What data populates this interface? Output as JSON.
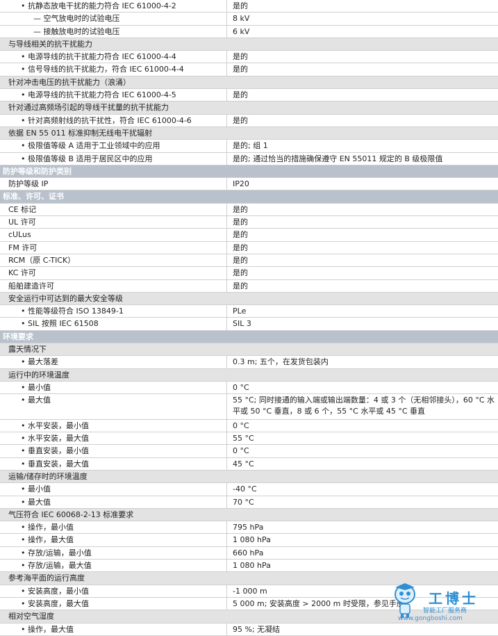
{
  "rows": [
    {
      "type": "item",
      "level": 1,
      "label": "抗静态放电干扰的能力符合 IEC 61000-4-2",
      "value": "是的"
    },
    {
      "type": "item",
      "level": 2,
      "label": "— 空气放电时的试验电压",
      "value": "8 kV"
    },
    {
      "type": "item",
      "level": 2,
      "label": "— 接触放电时的试验电压",
      "value": "6 kV"
    },
    {
      "type": "group",
      "label": "与导线相关的抗干扰能力"
    },
    {
      "type": "item",
      "level": 1,
      "label": "电源导线的抗干扰能力符合 IEC 61000-4-4",
      "value": "是的"
    },
    {
      "type": "item",
      "level": 1,
      "label": "信号导线的抗干扰能力，符合 IEC 61000-4-4",
      "value": "是的"
    },
    {
      "type": "group",
      "label": "针对冲击电压的抗干扰能力（浪涌）"
    },
    {
      "type": "item",
      "level": 1,
      "label": "电源导线的抗干扰能力符合 IEC 61000-4-5",
      "value": "是的"
    },
    {
      "type": "group",
      "label": "针对通过高频场引起的导线干扰量的抗干扰能力"
    },
    {
      "type": "item",
      "level": 1,
      "label": "针对高频射线的抗干扰性，符合 IEC 61000-4-6",
      "value": "是的"
    },
    {
      "type": "group",
      "label": "依据 EN 55 011 标准抑制无线电干扰辐射"
    },
    {
      "type": "item",
      "level": 1,
      "label": "极限值等级 A 适用于工业领域中的应用",
      "value": "是的; 组 1"
    },
    {
      "type": "item",
      "level": 1,
      "label": "极限值等级 B 适用于居民区中的应用",
      "value": "是的; 通过恰当的措施确保遵守 EN 55011 规定的 B 级极限值"
    },
    {
      "type": "section",
      "label": "防护等级和防护类别"
    },
    {
      "type": "item",
      "level": 0,
      "label": "防护等级 IP",
      "value": "IP20"
    },
    {
      "type": "section",
      "label": "标准、许可、证书"
    },
    {
      "type": "item",
      "level": 0,
      "label": "CE 标记",
      "value": "是的"
    },
    {
      "type": "item",
      "level": 0,
      "label": "UL 许可",
      "value": "是的"
    },
    {
      "type": "item",
      "level": 0,
      "label": "cULus",
      "value": "是的"
    },
    {
      "type": "item",
      "level": 0,
      "label": "FM 许可",
      "value": "是的"
    },
    {
      "type": "item",
      "level": 0,
      "label": "RCM（原 C-TICK）",
      "value": "是的"
    },
    {
      "type": "item",
      "level": 0,
      "label": "KC 许可",
      "value": "是的"
    },
    {
      "type": "item",
      "level": 0,
      "label": "船舶建造许可",
      "value": "是的"
    },
    {
      "type": "group",
      "label": "安全运行中可达到的最大安全等级"
    },
    {
      "type": "item",
      "level": 1,
      "label": "性能等级符合 ISO 13849-1",
      "value": "PLe"
    },
    {
      "type": "item",
      "level": 1,
      "label": "SIL 按照 IEC 61508",
      "value": "SIL 3"
    },
    {
      "type": "section",
      "label": "环境要求"
    },
    {
      "type": "group",
      "label": "露天情况下"
    },
    {
      "type": "item",
      "level": 1,
      "label": "最大落差",
      "value": "0.3 m; 五个，在发货包装内"
    },
    {
      "type": "group",
      "label": "运行中的环境温度"
    },
    {
      "type": "item",
      "level": 1,
      "label": "最小值",
      "value": "0 °C"
    },
    {
      "type": "item",
      "level": 1,
      "label": "最大值",
      "value": "55 °C; 同时接通的输入端或输出端数量：4 或 3 个（无相邻接头），60 °C 水平或 50 °C 垂直，8 或 6 个，55 °C 水平或 45 °C 垂直",
      "tall": true
    },
    {
      "type": "item",
      "level": 1,
      "label": "水平安装，最小值",
      "value": "0 °C"
    },
    {
      "type": "item",
      "level": 1,
      "label": "水平安装，最大值",
      "value": "55 °C"
    },
    {
      "type": "item",
      "level": 1,
      "label": "垂直安装，最小值",
      "value": "0 °C"
    },
    {
      "type": "item",
      "level": 1,
      "label": "垂直安装，最大值",
      "value": "45 °C"
    },
    {
      "type": "group",
      "label": "运输/储存时的环境温度"
    },
    {
      "type": "item",
      "level": 1,
      "label": "最小值",
      "value": "-40 °C"
    },
    {
      "type": "item",
      "level": 1,
      "label": "最大值",
      "value": "70 °C"
    },
    {
      "type": "group",
      "label": "气压符合 IEC 60068-2-13 标准要求"
    },
    {
      "type": "item",
      "level": 1,
      "label": "操作，最小值",
      "value": "795 hPa"
    },
    {
      "type": "item",
      "level": 1,
      "label": "操作，最大值",
      "value": "1 080 hPa"
    },
    {
      "type": "item",
      "level": 1,
      "label": "存放/运输，最小值",
      "value": "660 hPa"
    },
    {
      "type": "item",
      "level": 1,
      "label": "存放/运输，最大值",
      "value": "1 080 hPa"
    },
    {
      "type": "group",
      "label": "参考海平面的运行高度"
    },
    {
      "type": "item",
      "level": 1,
      "label": "安装高度，最小值",
      "value": "-1 000 m"
    },
    {
      "type": "item",
      "level": 1,
      "label": "安装高度，最大值",
      "value": "5 000 m; 安装高度 > 2000 m 时受限，参见手册"
    },
    {
      "type": "group",
      "label": "相对空气湿度"
    },
    {
      "type": "item",
      "level": 1,
      "label": "操作，最大值",
      "value": "95 %; 无凝结"
    }
  ],
  "watermark": {
    "name": "工博士",
    "subtitle": "智能工厂服务商",
    "url": "www.gongboshi.com",
    "color": "#2e8fd4"
  },
  "colors": {
    "section_bg": "#b9c2cc",
    "group_bg": "#e3e3e3",
    "border": "#cfcfcf"
  }
}
